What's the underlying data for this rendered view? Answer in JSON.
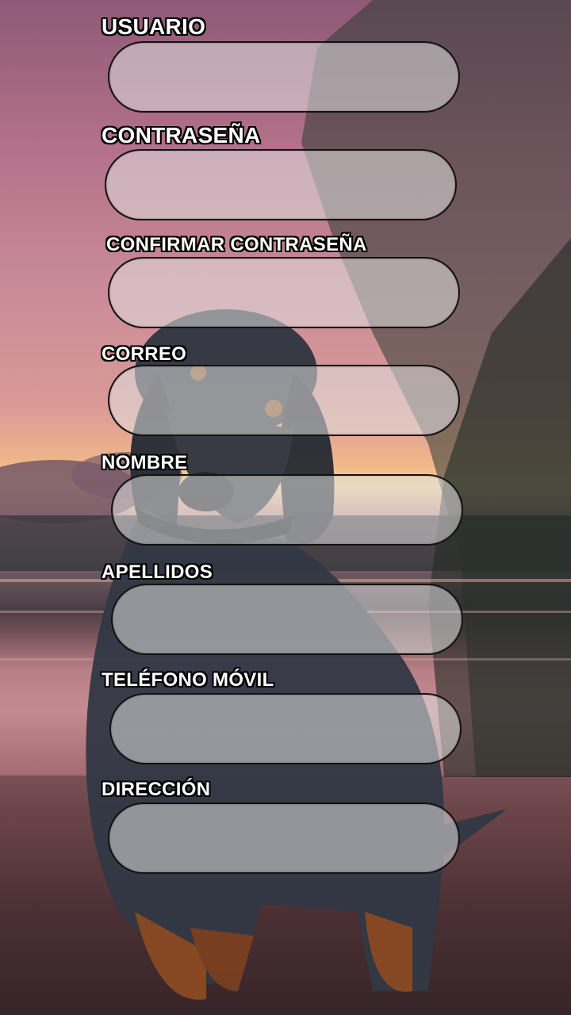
{
  "form": {
    "fields": [
      {
        "label": "USUARIO",
        "value": ""
      },
      {
        "label": "CONTRASEÑA",
        "value": ""
      },
      {
        "label": "CONFIRMAR CONTRASEÑA",
        "value": ""
      },
      {
        "label": "CORREO",
        "value": ""
      },
      {
        "label": "NOMBRE",
        "value": ""
      },
      {
        "label": "APELLIDOS",
        "value": ""
      },
      {
        "label": "TELÉFONO MÓVIL",
        "value": ""
      },
      {
        "label": "DIRECCIÓN",
        "value": ""
      }
    ]
  },
  "background": {
    "description_icon": "sunset-beach-dog-image",
    "colors": {
      "sky_top": "#8e5a78",
      "sky_glow": "#f4d29c",
      "sand": "#c48b90",
      "dog": "#2f3540"
    }
  }
}
